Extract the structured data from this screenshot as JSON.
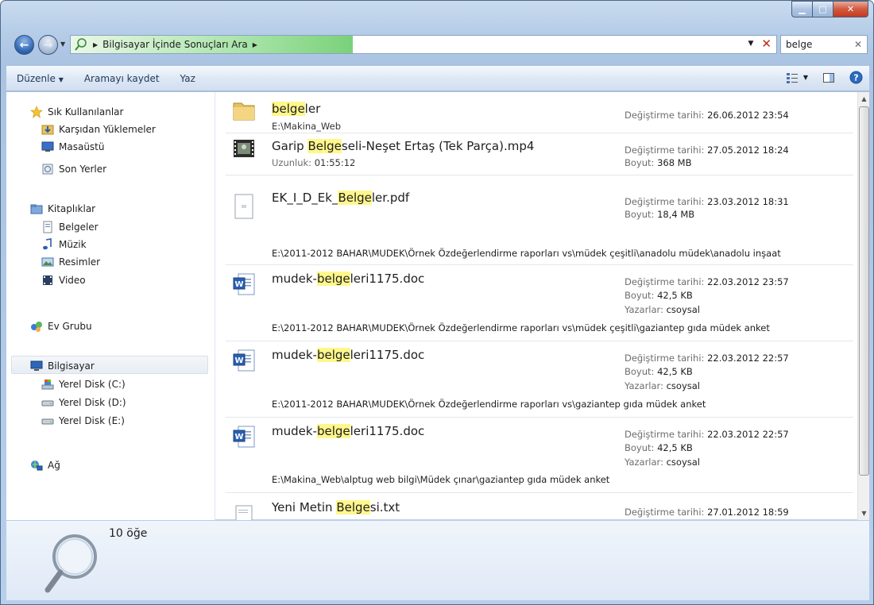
{
  "address": {
    "crumb": "Bilgisayar İçinde Sonuçları Ara",
    "search_value": "belge"
  },
  "toolbar": {
    "organize": "Düzenle",
    "save_search": "Aramayı kaydet",
    "burn": "Yaz"
  },
  "sidebar": {
    "favorites": "Sık Kullanılanlar",
    "downloads": "Karşıdan Yüklemeler",
    "desktop": "Masaüstü",
    "recent": "Son Yerler",
    "libraries": "Kitaplıklar",
    "documents": "Belgeler",
    "music": "Müzik",
    "pictures": "Resimler",
    "video": "Video",
    "homegroup": "Ev Grubu",
    "computer": "Bilgisayar",
    "disk_c": "Yerel Disk (C:)",
    "disk_d": "Yerel Disk (D:)",
    "disk_e": "Yerel Disk (E:)",
    "network": "Ağ"
  },
  "labels": {
    "modified": "Değiştirme tarihi:",
    "size": "Boyut:",
    "authors": "Yazarlar:",
    "length": "Uzunluk:"
  },
  "results": [
    {
      "pre": "",
      "hl": "belge",
      "post": "ler",
      "sub": "E:\\Makina_Web",
      "modified": "26.06.2012 23:54",
      "icon": "folder-icon"
    },
    {
      "pre": "Garip ",
      "hl": "Belge",
      "post": "seli-Neşet Ertaş (Tek Parça).mp4",
      "length": "01:55:12",
      "modified": "27.05.2012 18:24",
      "size": "368 MB",
      "icon": "video-file-icon"
    },
    {
      "pre": "EK_I_D_Ek_",
      "hl": "Belge",
      "post": "ler.pdf",
      "modified": "23.03.2012 18:31",
      "size": "18,4 MB",
      "path": "E:\\2011-2012 BAHAR\\MUDEK\\Örnek Özdeğerlendirme raporları vs\\müdek çeşitli\\anadolu müdek\\anadolu inşaat",
      "icon": "pdf-file-icon"
    },
    {
      "pre": "mudek-",
      "hl": "belge",
      "post": "leri1175.doc",
      "modified": "22.03.2012 23:57",
      "size": "42,5 KB",
      "author": "csoysal",
      "path": "E:\\2011-2012 BAHAR\\MUDEK\\Örnek Özdeğerlendirme raporları vs\\müdek çeşitli\\gaziantep gıda müdek anket",
      "icon": "word-doc-icon"
    },
    {
      "pre": "mudek-",
      "hl": "belge",
      "post": "leri1175.doc",
      "modified": "22.03.2012 22:57",
      "size": "42,5 KB",
      "author": "csoysal",
      "path": "E:\\2011-2012 BAHAR\\MUDEK\\Örnek Özdeğerlendirme raporları vs\\gaziantep gıda müdek anket",
      "icon": "word-doc-icon"
    },
    {
      "pre": "mudek-",
      "hl": "belge",
      "post": "leri1175.doc",
      "modified": "22.03.2012 22:57",
      "size": "42,5 KB",
      "author": "csoysal",
      "path": "E:\\Makina_Web\\alptug web bilgi\\Müdek çınar\\gaziantep gıda müdek anket",
      "icon": "word-doc-icon"
    },
    {
      "pre": "Yeni Metin ",
      "hl": "Belge",
      "post": "si.txt",
      "modified": "27.01.2012 18:59",
      "icon": "text-file-icon"
    }
  ],
  "status": {
    "count": "10 öğe"
  },
  "colors": {
    "highlight": "#fff78c",
    "selection": "#e7edf4",
    "title_gradient": "#b6cde8"
  }
}
